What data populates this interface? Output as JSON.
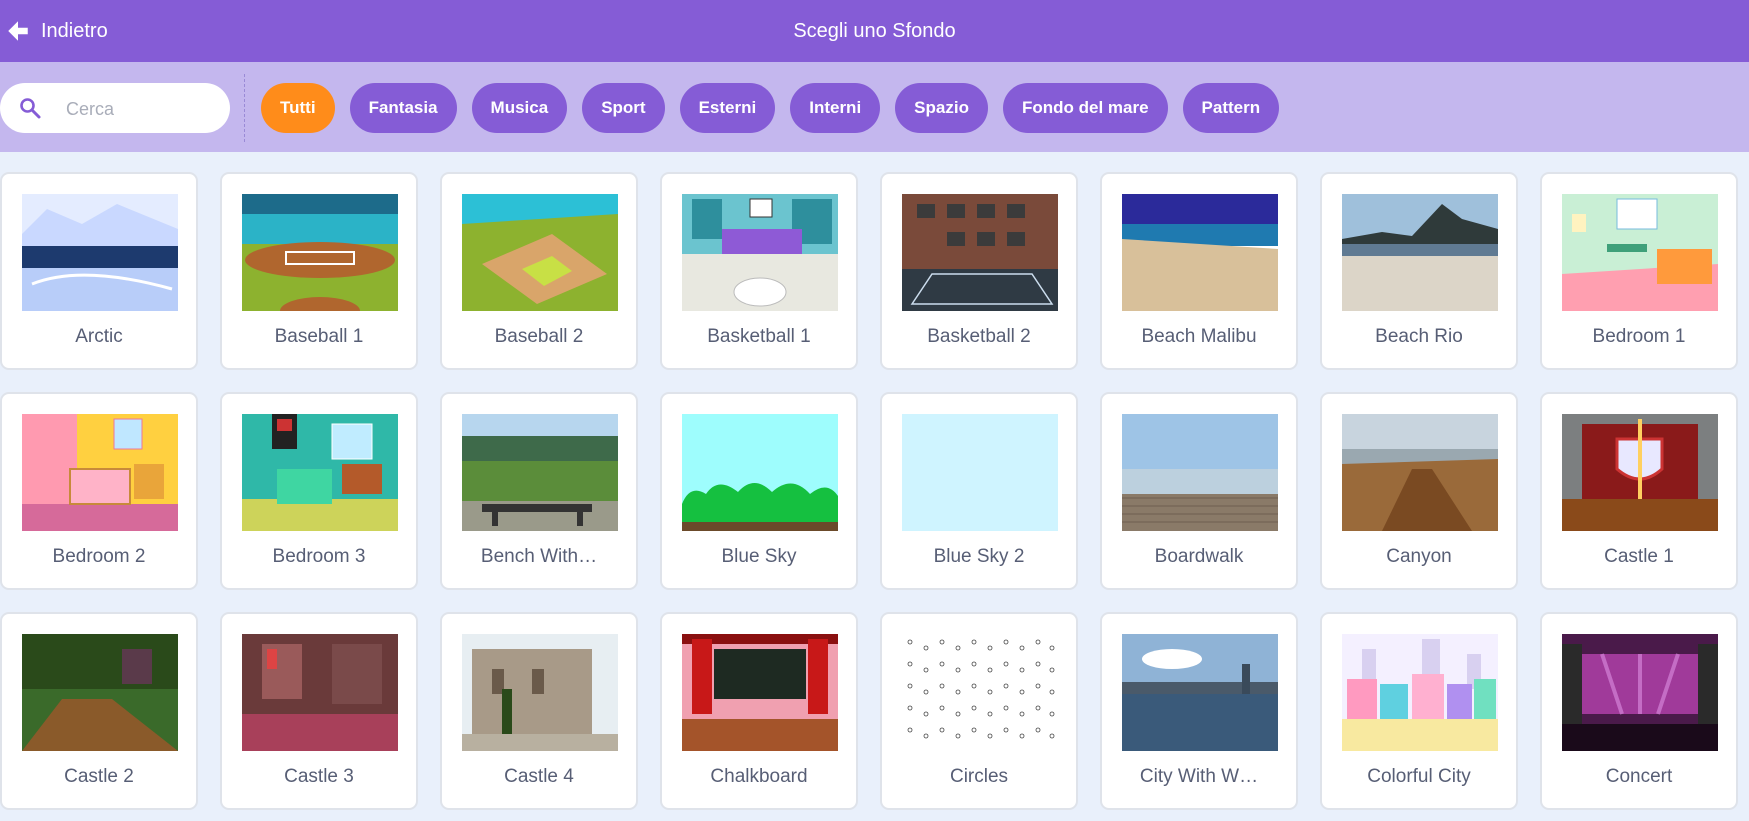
{
  "header": {
    "back_label": "Indietro",
    "title": "Scegli uno Sfondo"
  },
  "search": {
    "placeholder": "Cerca"
  },
  "tags": [
    {
      "label": "Tutti",
      "active": true
    },
    {
      "label": "Fantasia"
    },
    {
      "label": "Musica"
    },
    {
      "label": "Sport"
    },
    {
      "label": "Esterni"
    },
    {
      "label": "Interni"
    },
    {
      "label": "Spazio"
    },
    {
      "label": "Fondo del mare"
    },
    {
      "label": "Pattern"
    }
  ],
  "backdrops": [
    {
      "label": "Arctic"
    },
    {
      "label": "Baseball 1"
    },
    {
      "label": "Baseball 2"
    },
    {
      "label": "Basketball 1"
    },
    {
      "label": "Basketball 2"
    },
    {
      "label": "Beach Malibu"
    },
    {
      "label": "Beach Rio"
    },
    {
      "label": "Bedroom 1"
    },
    {
      "label": "Bedroom 2"
    },
    {
      "label": "Bedroom 3"
    },
    {
      "label": "Bench With…"
    },
    {
      "label": "Blue Sky"
    },
    {
      "label": "Blue Sky 2"
    },
    {
      "label": "Boardwalk"
    },
    {
      "label": "Canyon"
    },
    {
      "label": "Castle 1"
    },
    {
      "label": "Castle 2"
    },
    {
      "label": "Castle 3"
    },
    {
      "label": "Castle 4"
    },
    {
      "label": "Chalkboard"
    },
    {
      "label": "Circles"
    },
    {
      "label": "City With W…"
    },
    {
      "label": "Colorful City"
    },
    {
      "label": "Concert"
    }
  ]
}
